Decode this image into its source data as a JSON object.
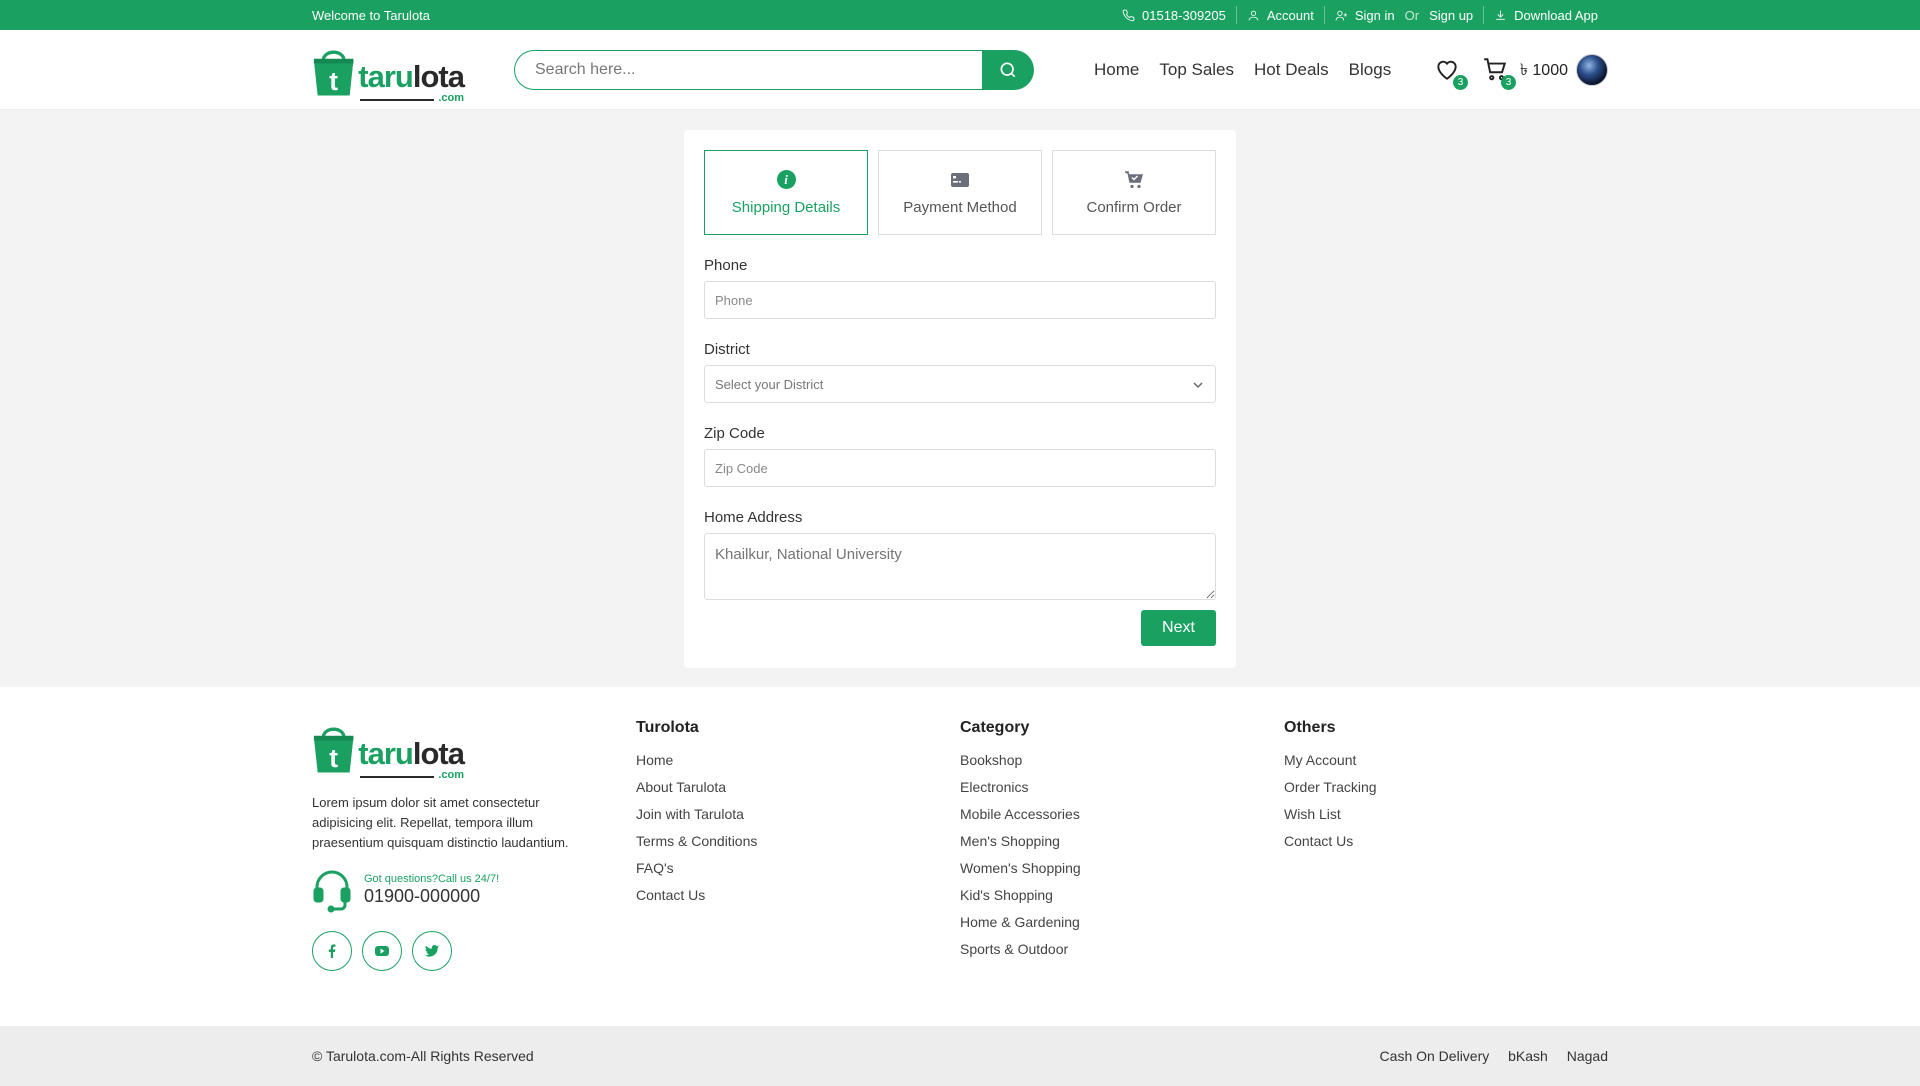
{
  "topbar": {
    "welcome": "Welcome to Tarulota",
    "phone": "01518-309205",
    "account": "Account",
    "sign_in": "Sign in",
    "or": "Or",
    "sign_up": "Sign up",
    "download": "Download App"
  },
  "header": {
    "logo_part1": "taru",
    "logo_part2": "lota",
    "logo_suffix": ".com",
    "logo_letter": "t",
    "search_placeholder": "Search here...",
    "nav": [
      "Home",
      "Top Sales",
      "Hot Deals",
      "Blogs"
    ],
    "wishlist_count": "3",
    "cart_count": "3",
    "cart_total": "৳ 1000"
  },
  "checkout": {
    "steps": [
      {
        "label": "Shipping Details",
        "icon": "info-icon",
        "active": true
      },
      {
        "label": "Payment Method",
        "icon": "credit-card-icon",
        "active": false
      },
      {
        "label": "Confirm Order",
        "icon": "cart-check-icon",
        "active": false
      }
    ],
    "phone_label": "Phone",
    "phone_placeholder": "Phone",
    "district_label": "District",
    "district_selected": "Select your District",
    "zip_label": "Zip Code",
    "zip_placeholder": "Zip Code",
    "address_label": "Home Address",
    "address_placeholder": "Khailkur, National University",
    "next_label": "Next"
  },
  "footer": {
    "description": "Lorem ipsum dolor sit amet consectetur adipisicing elit. Repellat, tempora illum praesentium quisquam distinctio laudantium.",
    "question": "Got questions?Call us 24/7!",
    "hotline": "01900-000000",
    "social": [
      "facebook-icon",
      "youtube-icon",
      "twitter-icon"
    ],
    "columns": [
      {
        "heading": "Turolota",
        "links": [
          "Home",
          "About Tarulota",
          "Join with Tarulota",
          "Terms & Conditions",
          "FAQ's",
          "Contact Us"
        ]
      },
      {
        "heading": "Category",
        "links": [
          "Bookshop",
          "Electronics",
          "Mobile Accessories",
          "Men's Shopping",
          "Women's Shopping",
          "Kid's Shopping",
          "Home & Gardening",
          "Sports & Outdoor"
        ]
      },
      {
        "heading": "Others",
        "links": [
          "My Account",
          "Order Tracking",
          "Wish List",
          "Contact Us"
        ]
      }
    ],
    "copyright": "© Tarulota.com-All Rights Reserved",
    "payments": [
      "Cash On Delivery",
      "bKash",
      "Nagad"
    ]
  },
  "colors": {
    "brand": "#1aa161",
    "bg": "#f3f3f3"
  }
}
